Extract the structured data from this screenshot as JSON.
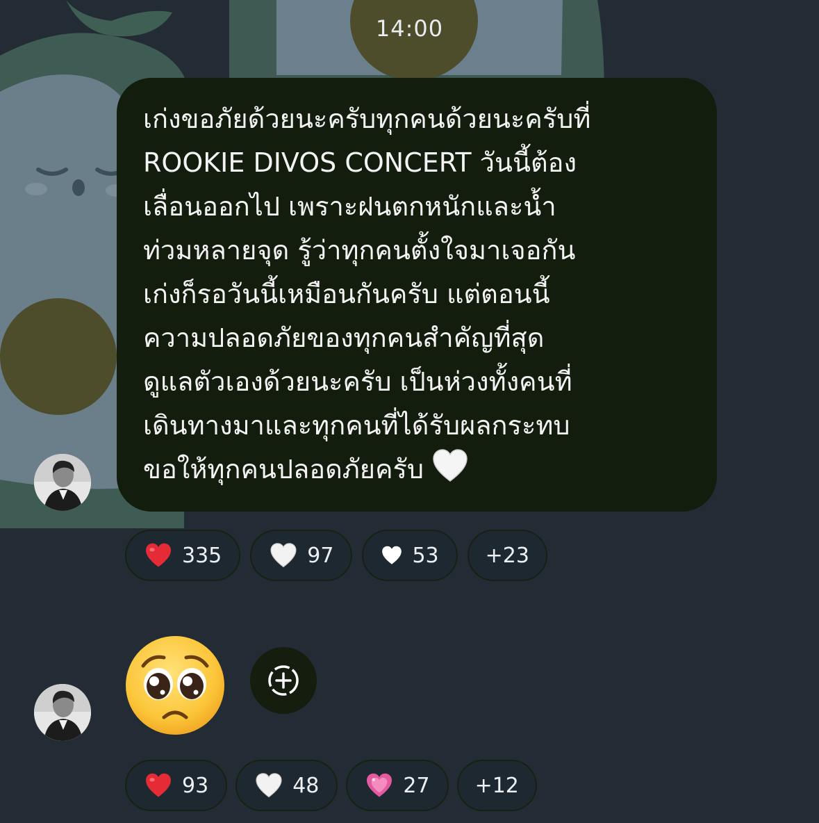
{
  "header": {
    "time": "14:00"
  },
  "messages": [
    {
      "text": "เก่งขอภัยด้วยนะครับทุกคนด้วยนะครับที่\nROOKIE DIVOS CONCERT วันนี้ต้อง\nเลื่อนออกไป เพราะฝนตกหนักและน้ำ\nท่วมหลายจุด รู้ว่าทุกคนตั้งใจมาเจอกัน\nเก่งก็รอวันนี้เหมือนกันครับ แต่ตอนนี้\nความปลอดภัยของทุกคนสำคัญที่สุด\nดูแลตัวเองด้วยนะครับ เป็นห่วงทั้งคนที่\nเดินทางมาและทุกคนที่ได้รับผลกระทบ\nขอให้ทุกคนปลอดภัยครับ",
      "trailing_icon": "white-heart-icon",
      "reactions": [
        {
          "icon": "red-heart-icon",
          "count": "335"
        },
        {
          "icon": "white-heart-icon",
          "count": "97"
        },
        {
          "icon": "small-white-heart-icon",
          "count": "53"
        }
      ],
      "more": "+23"
    },
    {
      "emoji": "pleading-face-icon",
      "reactions": [
        {
          "icon": "red-heart-icon",
          "count": "93"
        },
        {
          "icon": "white-heart-icon",
          "count": "48"
        },
        {
          "icon": "pink-heart-icon",
          "count": "27"
        }
      ],
      "more": "+12"
    }
  ],
  "colors": {
    "background": "#232c35",
    "bubble": "#131d0d",
    "chip_border": "#182013",
    "text": "#f3f3f3",
    "red_heart": "#e52b35",
    "pink_heart": "#e45a9e"
  }
}
